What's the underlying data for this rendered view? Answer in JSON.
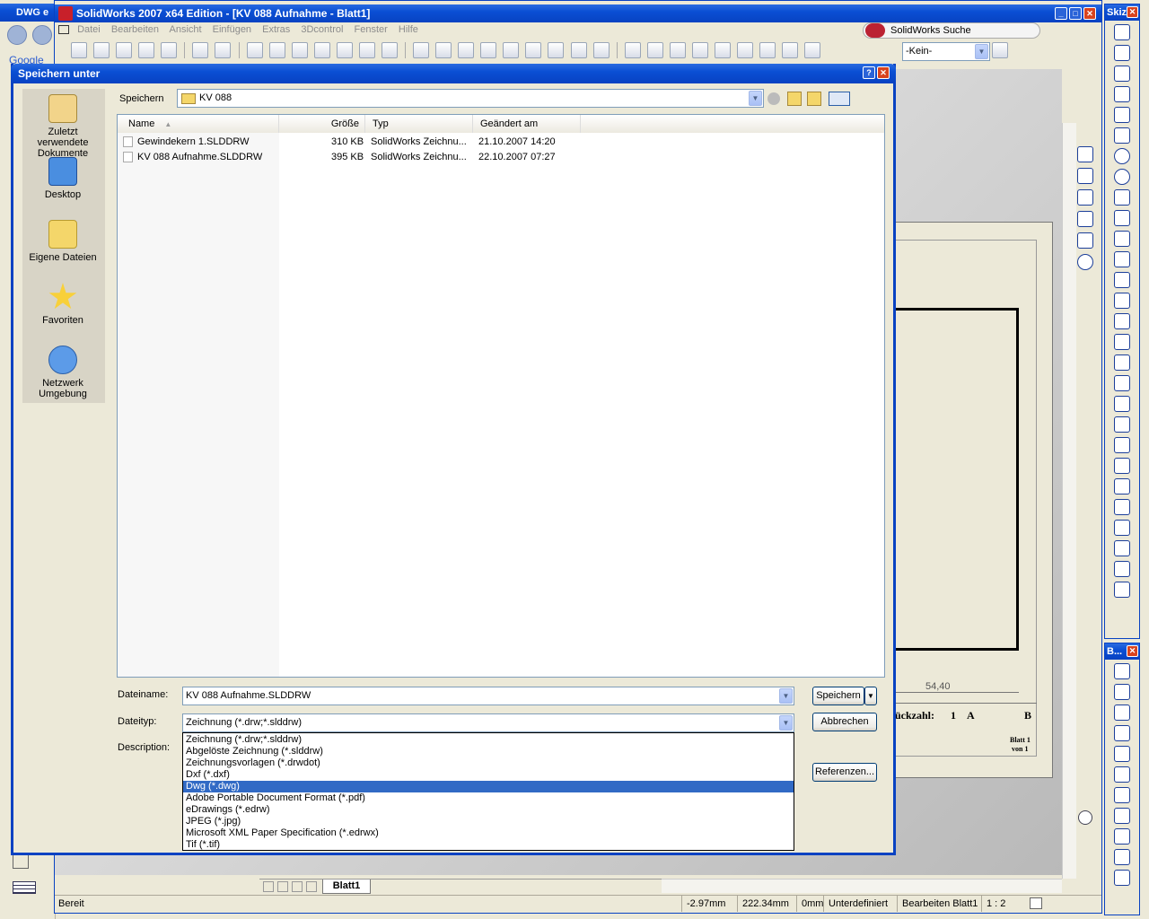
{
  "taskbar_left": {
    "tab_label": "DWG e",
    "google_label": "Google"
  },
  "app": {
    "title": "SolidWorks 2007 x64 Edition - [KV 088 Aufnahme - Blatt1]",
    "menu": [
      "Datei",
      "Bearbeiten",
      "Ansicht",
      "Einfügen",
      "Extras",
      "3Dcontrol",
      "Fenster",
      "Hilfe"
    ],
    "search_label": "SolidWorks Suche",
    "layer_select": "-Kein-"
  },
  "sketch_panel": {
    "title": "Skiz..."
  },
  "b_panel": {
    "title": "B..."
  },
  "drawing": {
    "dimension": "54,40",
    "stueckzahl_label": "ückzahl:",
    "stueckzahl_value": "1",
    "col_a": "A",
    "col_b": "B",
    "blatt_label": "Blatt 1",
    "von_label": "von 1",
    "sheet_tab": "Blatt1"
  },
  "status": {
    "ready": "Bereit",
    "x": "-2.97mm",
    "y": "222.34mm",
    "z": "0mm",
    "state": "Unterdefiniert",
    "editing": "Bearbeiten Blatt1",
    "scale": "1 : 2"
  },
  "dialog": {
    "title": "Speichern unter",
    "help_glyph": "?",
    "close_glyph": "✕",
    "save_in_label": "Speichern",
    "save_in_value": "KV 088",
    "places": [
      {
        "label": "Zuletzt verwendete Dokumente"
      },
      {
        "label": "Desktop"
      },
      {
        "label": "Eigene Dateien"
      },
      {
        "label": "Favoriten"
      },
      {
        "label": "Netzwerk Umgebung"
      }
    ],
    "columns": {
      "name": "Name",
      "size": "Größe",
      "type": "Typ",
      "modified": "Geändert am"
    },
    "files": [
      {
        "name": "Gewindekern 1.SLDDRW",
        "size": "310 KB",
        "type": "SolidWorks Zeichnu...",
        "modified": "21.10.2007 14:20"
      },
      {
        "name": "KV 088 Aufnahme.SLDDRW",
        "size": "395 KB",
        "type": "SolidWorks Zeichnu...",
        "modified": "22.10.2007 07:27"
      }
    ],
    "filename_label": "Dateiname:",
    "filename_value": "KV 088 Aufnahme.SLDDRW",
    "filetype_label": "Dateityp:",
    "filetype_value": "Zeichnung (*.drw;*.slddrw)",
    "description_label": "Description:",
    "save_button": "Speichern",
    "cancel_button": "Abbrechen",
    "references_button": "Referenzen...",
    "filetype_options": [
      "Zeichnung (*.drw;*.slddrw)",
      "Abgelöste Zeichnung (*.slddrw)",
      "Zeichnungsvorlagen (*.drwdot)",
      "Dxf (*.dxf)",
      "Dwg (*.dwg)",
      "Adobe Portable Document Format (*.pdf)",
      "eDrawings (*.edrw)",
      "JPEG (*.jpg)",
      "Microsoft XML Paper Specification (*.edrwx)",
      "Tif (*.tif)"
    ],
    "selected_option": "Dwg (*.dwg)"
  },
  "colors": {
    "xp_blue": "#0a4fd4",
    "selection": "#316ac5",
    "sheet_border": "#000000"
  }
}
